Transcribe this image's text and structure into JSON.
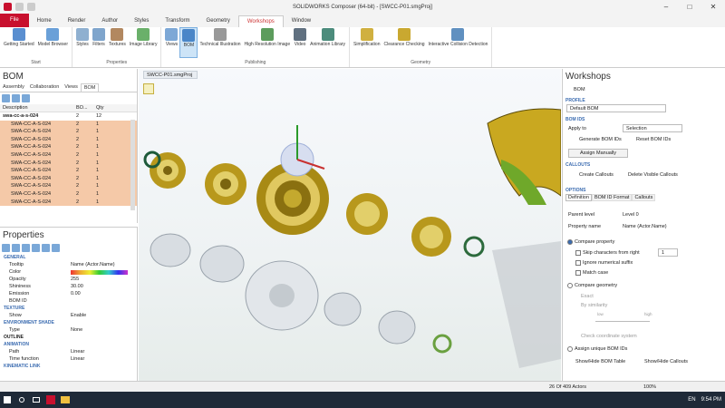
{
  "window": {
    "title": "SOLIDWORKS Composer (64-bit) - [SWCC-P01.smgProj]"
  },
  "tabs": [
    "File",
    "Home",
    "Render",
    "Author",
    "Styles",
    "Transform",
    "Geometry",
    "Workshops",
    "Window"
  ],
  "ribbon": {
    "groups": [
      {
        "label": "Start",
        "buttons": [
          "Getting Started",
          "Model Browser"
        ]
      },
      {
        "label": "Properties",
        "buttons": [
          "Styles",
          "Filters",
          "Textures",
          "Image Library"
        ]
      },
      {
        "label": "Publishing",
        "buttons": [
          "Views",
          "BOM",
          "Technical Illustration",
          "High Resolution Image",
          "Video",
          "Animation Library"
        ]
      },
      {
        "label": "Geometry",
        "buttons": [
          "Simplification",
          "Clearance Checking",
          "Interactive Collision Detection"
        ]
      }
    ]
  },
  "bom_panel": {
    "title": "BOM",
    "tabs": [
      "Assembly",
      "Collaboration",
      "Views",
      "BOM"
    ],
    "columns": [
      "Description",
      "BO...",
      "Qty"
    ],
    "rows": [
      {
        "desc": "swa-cc-a-s-024",
        "bom": "2",
        "qty": "12"
      },
      {
        "desc": "SWA-CC-A-S-024",
        "bom": "2",
        "qty": "1"
      },
      {
        "desc": "SWA-CC-A-S-024",
        "bom": "2",
        "qty": "1"
      },
      {
        "desc": "SWA-CC-A-S-024",
        "bom": "2",
        "qty": "1"
      },
      {
        "desc": "SWA-CC-A-S-024",
        "bom": "2",
        "qty": "1"
      },
      {
        "desc": "SWA-CC-A-S-024",
        "bom": "2",
        "qty": "1"
      },
      {
        "desc": "SWA-CC-A-S-024",
        "bom": "2",
        "qty": "1"
      },
      {
        "desc": "SWA-CC-A-S-024",
        "bom": "2",
        "qty": "1"
      },
      {
        "desc": "SWA-CC-A-S-024",
        "bom": "2",
        "qty": "1"
      },
      {
        "desc": "SWA-CC-A-S-024",
        "bom": "2",
        "qty": "1"
      },
      {
        "desc": "SWA-CC-A-S-024",
        "bom": "2",
        "qty": "1"
      },
      {
        "desc": "SWA-CC-A-S-024",
        "bom": "2",
        "qty": "1"
      }
    ]
  },
  "properties": {
    "title": "Properties",
    "general": "GENERAL",
    "tooltip_k": "Tooltip",
    "tooltip_v": "Name (Actor.Name)",
    "color_k": "Color",
    "opacity_k": "Opacity",
    "opacity_v": "255",
    "shininess_k": "Shininess",
    "shininess_v": "30.00",
    "emission_k": "Emission",
    "emission_v": "0.00",
    "bomid_k": "BOM ID",
    "texture": "TEXTURE",
    "show_k": "Show",
    "show_v": "Enable",
    "envshadow": "ENVIRONMENT SHADE",
    "type_k": "Type",
    "type_v": "None",
    "outline": "OUTLINE",
    "animation": "ANIMATION",
    "path_k": "Path",
    "path_v": "Linear",
    "timefn_k": "Time function",
    "timefn_v": "Linear",
    "kinematic": "KINEMATIC LINK"
  },
  "viewport": {
    "tab": "SWCC-P01.smgProj"
  },
  "workshops": {
    "title": "Workshops",
    "bom_label": "BOM",
    "profile": "PROFILE",
    "profile_value": "Default BOM",
    "bom_ids": "BOM IDS",
    "apply_to": "Apply to",
    "apply_value": "Selection",
    "generate": "Generate BOM IDs",
    "reset": "Reset BOM IDs",
    "assign": "Assign Manually",
    "callouts": "CALLOUTS",
    "create_callouts": "Create Callouts",
    "delete_callouts": "Delete Visible Callouts",
    "options": "OPTIONS",
    "opt_tabs": [
      "Definition",
      "BOM ID Format",
      "Callouts"
    ],
    "parent_level": "Parent level",
    "parent_value": "Level 0",
    "property_name": "Property name",
    "property_value": "Name (Actor.Name)",
    "compare_property": "Compare property",
    "skip_chars": "Skip characters from right",
    "skip_value": "1",
    "ignore_suffix": "Ignore numerical suffix",
    "match_case": "Match case",
    "compare_geometry": "Compare geometry",
    "exact": "Exact",
    "by_similarity": "By similarity",
    "low": "low",
    "high": "high",
    "check_coord": "Check coordinate system",
    "assign_unique": "Assign unique BOM IDs",
    "show_hide_table": "Show/Hide BOM Table",
    "show_hide_callouts": "Show/Hide Callouts"
  },
  "statusbar": {
    "actors": "26 Of 409 Actors",
    "zoom": "100%"
  },
  "taskbar": {
    "lang": "EN",
    "time": "9:54 PM"
  },
  "colors": {
    "accent": "#c8102e",
    "highlight": "#f5c9a8",
    "part_gold": "#c9a820",
    "part_green": "#6fa82a"
  }
}
